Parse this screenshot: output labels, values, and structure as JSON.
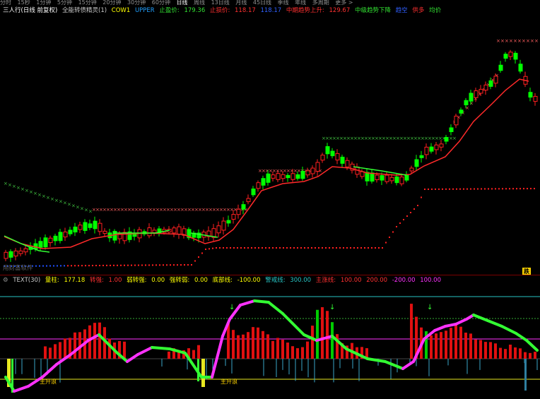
{
  "toolbar": {
    "items": [
      "分时",
      "15秒",
      "1分钟",
      "5分钟",
      "15分钟",
      "20分钟",
      "30分钟",
      "60分钟",
      "日线",
      "周线",
      "13日线",
      "月线",
      "45日线",
      "季线",
      "年线",
      "多周期",
      "更多 >"
    ],
    "active_index": 8
  },
  "legend_top": {
    "stock": "三人行(日线 前复权)",
    "indicator": "全能转债精灵(1)",
    "cow": "COW1",
    "upper": "UPPER",
    "stop_profit_label": "止盈价:",
    "stop_profit_value": "179.36",
    "stop_loss_label": "止损价:",
    "stop_loss_value": "118.17",
    "support_value": "118.17",
    "mid_up_label": "中期趋势上升:",
    "mid_up_value": "129.67",
    "mid_down_label": "中级趋势下降",
    "blue_label": "趋空",
    "buy_label": "供多",
    "avg_label": "均价"
  },
  "legend_bottom": {
    "name": "TEXT(30)",
    "vol_label": "量柱:",
    "vol_value": "177.18",
    "t1_label": "转强:",
    "t1_value": "1.00",
    "t2_label": "弱转强:",
    "t2_value": "0.00",
    "t3_label": "强转弱:",
    "t3_value": "0.00",
    "t4_label": "底部线:",
    "t4_value": "-100.00",
    "t5_label": "警戒线:",
    "t5_value": "300.00",
    "t6_label": "主涨线:",
    "t6_value": "100.00",
    "t6b_value": "200.00",
    "t7_value": "-200.00",
    "t7b_value": "100.00"
  },
  "watermark": "用财富软件",
  "badge": "跌",
  "labels": {
    "main_rise_1": "主升浪",
    "main_rise_2": "主升浪"
  },
  "colors": {
    "up": "#ff2020",
    "down": "#00ff00",
    "ma": "#ff2a2a",
    "mid": "#d0d0d0",
    "x_upper": "#ff6060",
    "x_lower": "#40c040",
    "dots": "#ff2020",
    "cyan": "#27c4c4",
    "magenta": "#ff32ff",
    "yellow": "#e8e820",
    "green_line": "#33ff33"
  }
}
